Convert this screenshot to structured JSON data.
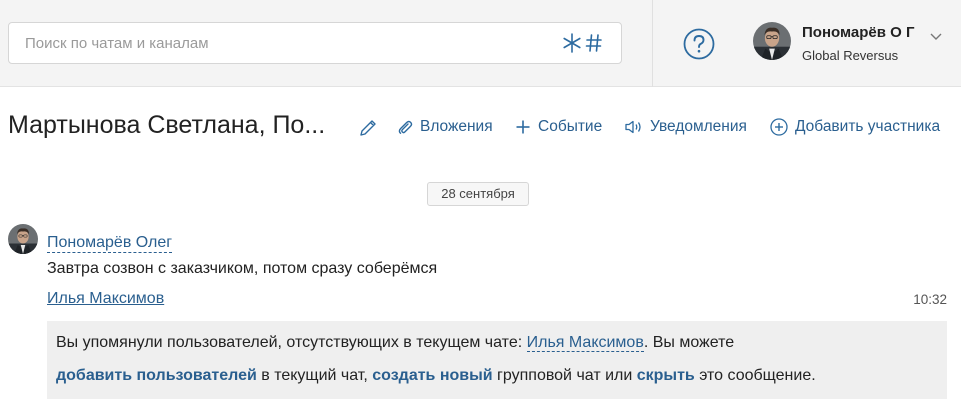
{
  "search": {
    "placeholder": "Поиск по чатам и каналам",
    "icons": [
      "asterisk-icon",
      "hash-icon"
    ]
  },
  "header": {
    "help_icon": "question-circle-icon",
    "user": {
      "name": "Пономарёв О Г",
      "org": "Global Reversus"
    }
  },
  "chat": {
    "title": "Мартынова Светлана, По...",
    "actions": {
      "attachments": "Вложения",
      "event": "Событие",
      "notifications": "Уведомления",
      "add_member": "Добавить участника"
    }
  },
  "feed": {
    "date": "28 сентября",
    "message": {
      "author": "Пономарёв Олег",
      "text": "Завтра созвон с заказчиком, потом сразу соберёмся",
      "mention": "Илья Максимов",
      "time": "10:32"
    },
    "notice": {
      "part1": "Вы упомянули пользователей, отсутствующих в текущем чате: ",
      "user": "Илья Максимов",
      "part2": ". Вы можете",
      "add_link": "добавить пользователей",
      "part3": " в текущий чат, ",
      "create_link": "создать новый",
      "part4": " групповой чат или ",
      "hide_link": "скрыть",
      "part5": " это сообщение."
    }
  },
  "colors": {
    "link": "#2a5f8f",
    "icon": "#2d6ba0",
    "topbar": "#f4f4f4",
    "notice_bg": "#efefef"
  }
}
